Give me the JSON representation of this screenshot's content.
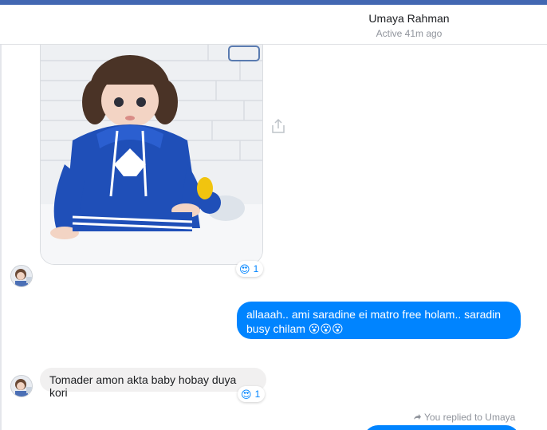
{
  "header": {
    "contact_name": "Umaya Rahman",
    "status": "Active 41m ago"
  },
  "messages": [
    {
      "from": "them",
      "kind": "photo",
      "reaction": {
        "emoji": "😍",
        "count": "1"
      }
    },
    {
      "from": "me",
      "text": "allaaah.. ami saradine ei matro free holam.. saradin busy chilam 😮😮😮"
    },
    {
      "from": "them",
      "text": "Tomader amon akta baby hobay duya kori",
      "reaction": {
        "emoji": "😍",
        "count": "1"
      }
    }
  ],
  "reply_note": "You replied to Umaya",
  "colors": {
    "accent": "#0084ff",
    "incoming_bubble": "#f1f0f0",
    "topbar": "#4267b2"
  },
  "icons": [
    "share-icon",
    "reply-arrow-icon"
  ]
}
